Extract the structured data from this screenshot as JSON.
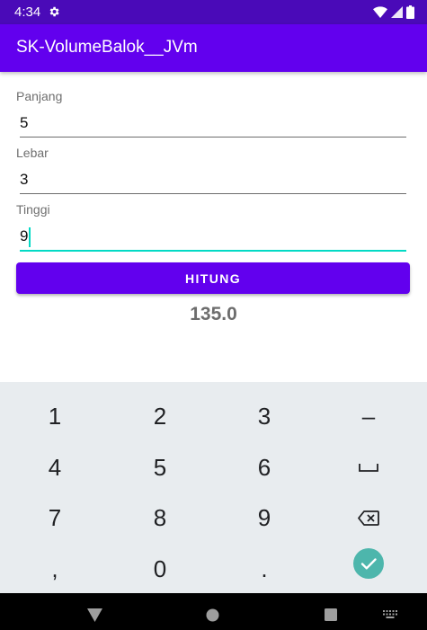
{
  "status_bar": {
    "time": "4:34"
  },
  "app_bar": {
    "title": "SK-VolumeBalok__JVm"
  },
  "form": {
    "panjang": {
      "label": "Panjang",
      "value": "5"
    },
    "lebar": {
      "label": "Lebar",
      "value": "3"
    },
    "tinggi": {
      "label": "Tinggi",
      "value": "9"
    }
  },
  "button": {
    "label": "HITUNG"
  },
  "result": {
    "value": "135.0"
  },
  "keyboard": {
    "row1": [
      "1",
      "2",
      "3",
      "–"
    ],
    "row2": [
      "4",
      "5",
      "6"
    ],
    "row3": [
      "7",
      "8",
      "9"
    ],
    "row4": [
      ",",
      "0",
      "."
    ]
  },
  "colors": {
    "status_bar": "#4a0ab8",
    "primary": "#6200ee",
    "accent": "#03dac5",
    "keyboard_bg": "#e8ecef",
    "enter_key": "#4db6ac"
  },
  "icons": [
    "gear-icon",
    "wifi-icon",
    "signal-icon",
    "battery-icon",
    "space-icon",
    "backspace-icon",
    "check-icon",
    "back-icon",
    "home-icon",
    "recents-icon",
    "keyboard-icon"
  ]
}
